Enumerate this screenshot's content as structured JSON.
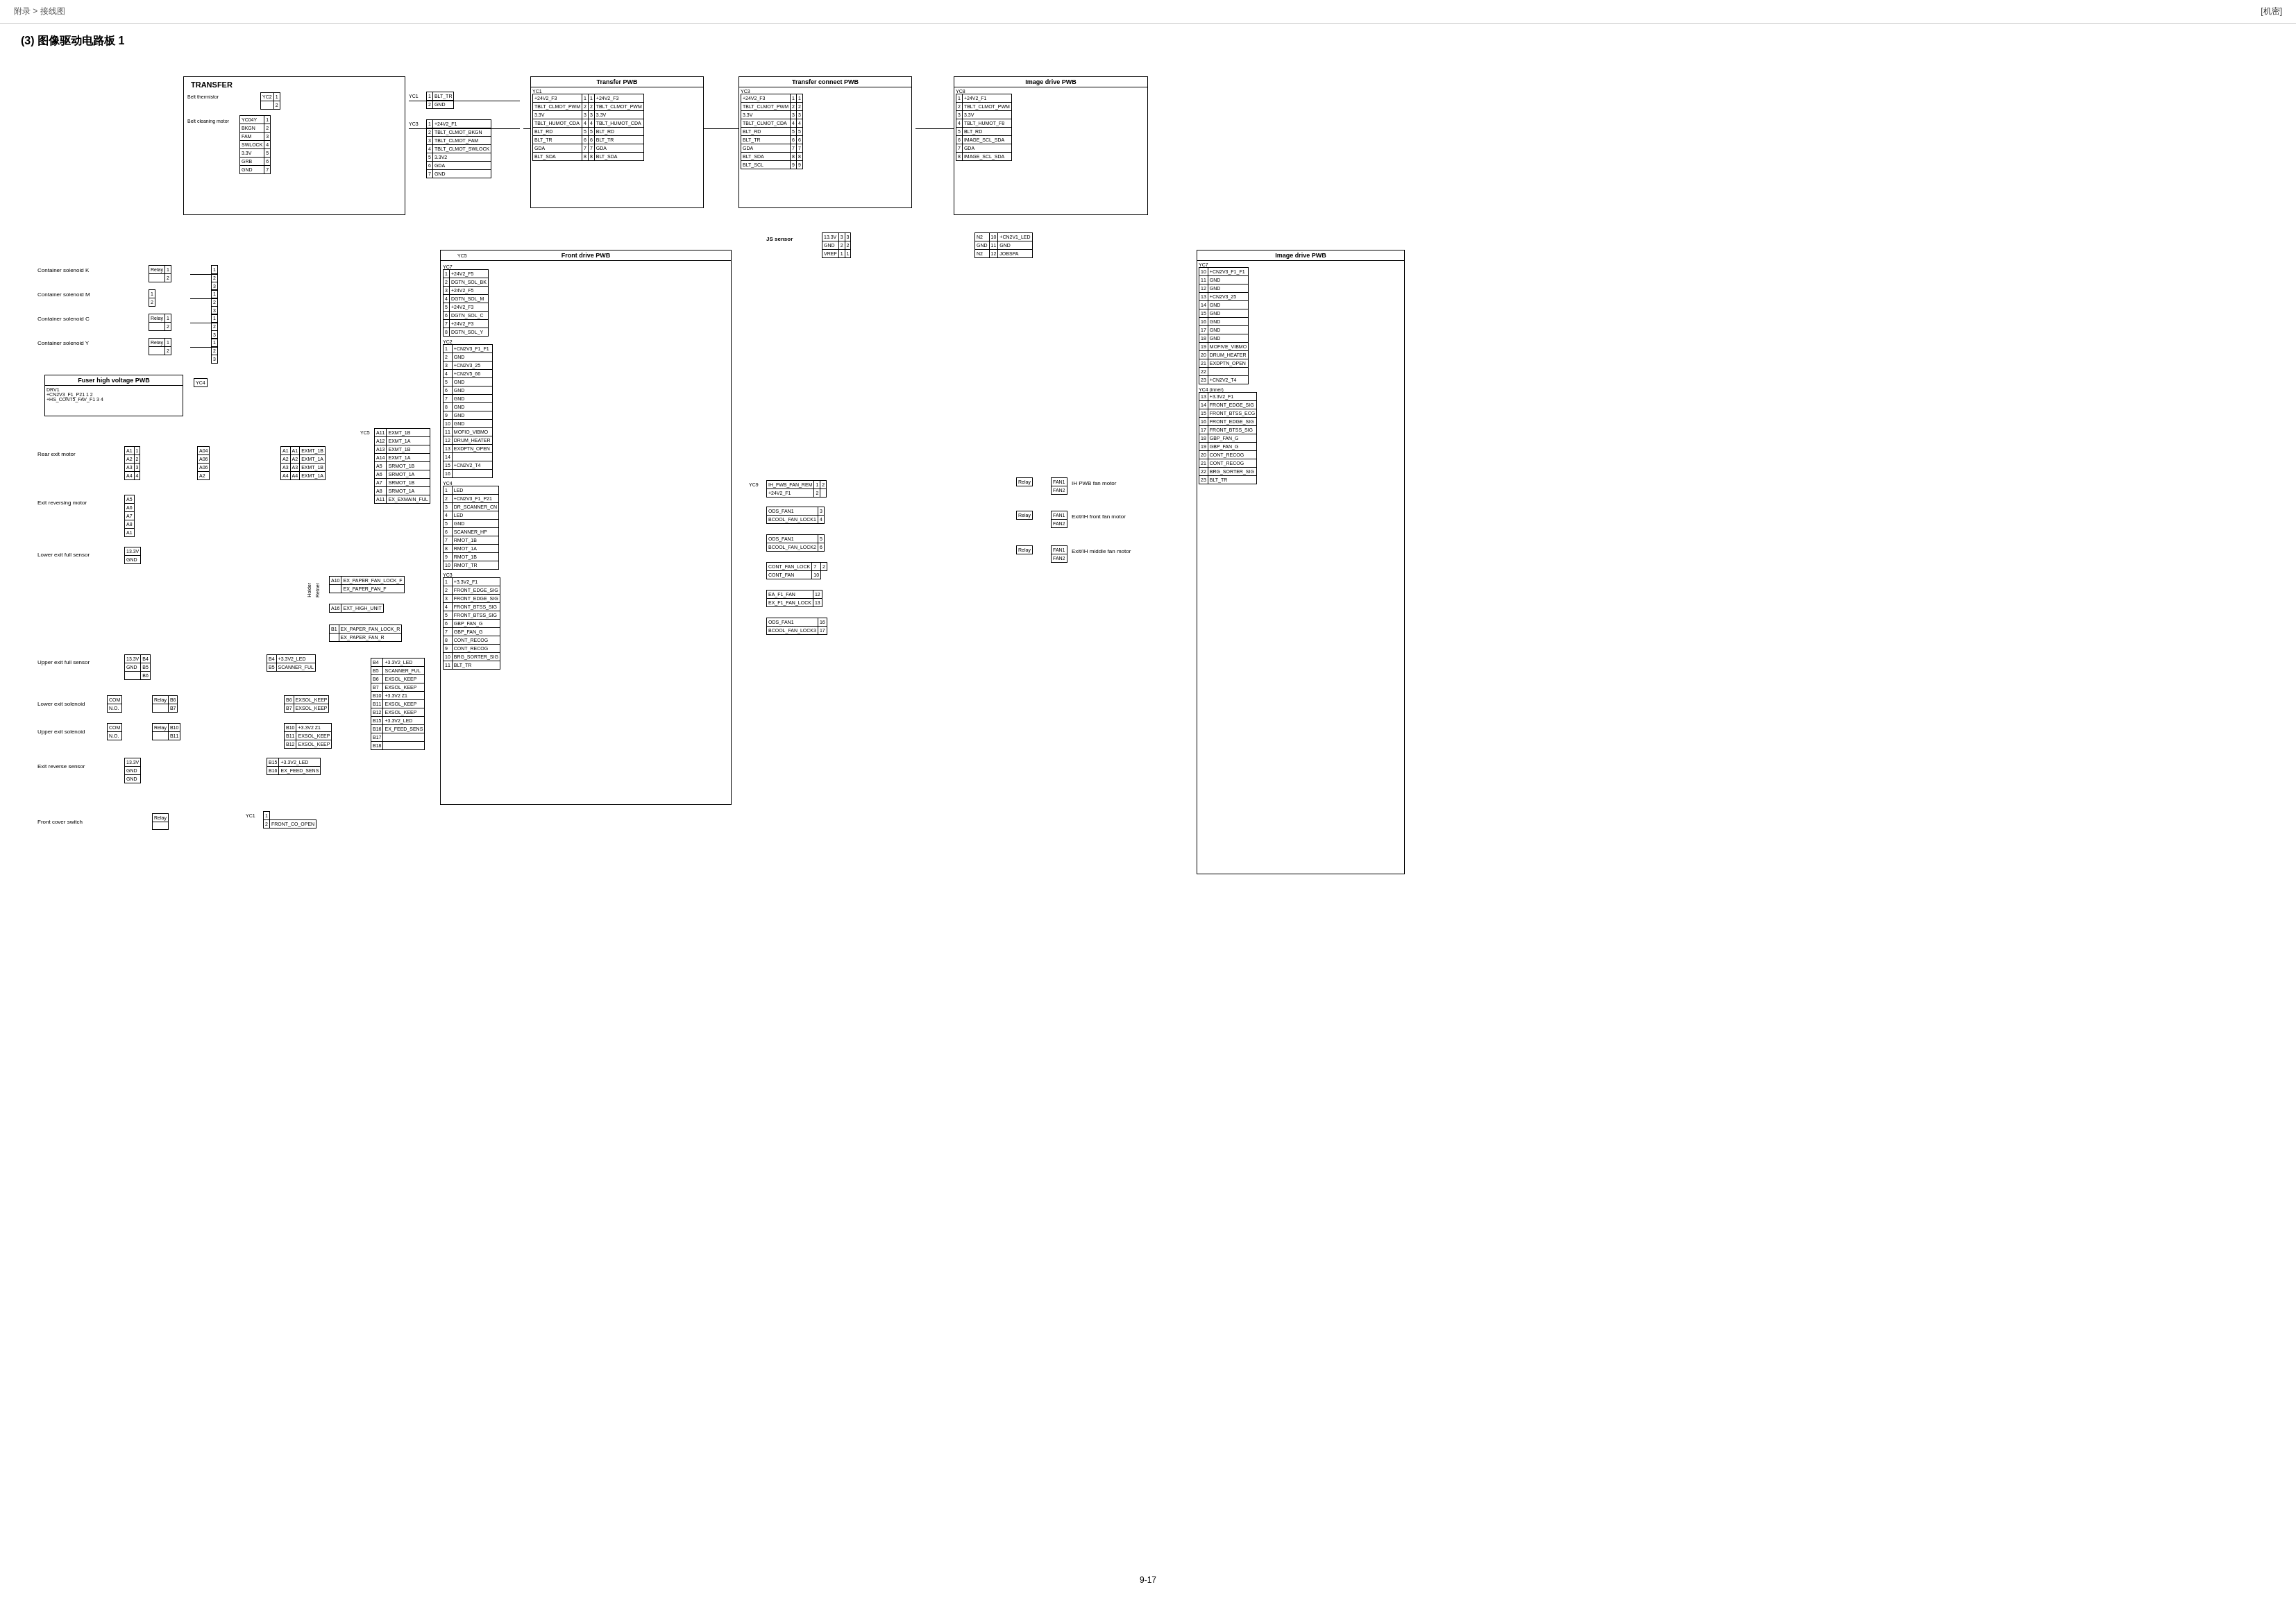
{
  "header": {
    "breadcrumb": "附录 > 接线图",
    "tag": "[机密]"
  },
  "section": {
    "title": "(3) 图像驱动电路板 1"
  },
  "blocks": {
    "transfer_pwb": "Transfer PWB",
    "transfer_connect_pwb": "Transfer connect PWB",
    "image_drive_pwb": "Image drive PWB",
    "front_drive_pwb": "Front drive PWB",
    "js_sensor": "JS sensor",
    "fuser_high_voltage": "Fuser high voltage PWB",
    "transfer_label": "TRANSFER"
  },
  "components": {
    "front_cover_switch": "Front cover switch",
    "belt_thermistor": "Belt thermistor",
    "belt_cleaning_motor": "Belt cleaning motor",
    "container_solenoid_k": "Container solenoid K",
    "container_solenoid_m": "Container solenoid M",
    "container_solenoid_c": "Container solenoid C",
    "container_solenoid_y": "Container solenoid Y",
    "rear_exit_motor": "Rear exit motor",
    "exit_reversing_motor": "Exit reversing motor",
    "lower_exit_full_sensor": "Lower exit full sensor",
    "upper_exit_full_sensor": "Upper exit full sensor",
    "lower_exit_solenoid": "Lower exit solenoid",
    "upper_exit_solenoid": "Upper exit solenoid",
    "exit_reverse_sensor": "Exit reverse sensor",
    "ih_pwb_fan_motor": "IH PWB fan motor",
    "exit_ih_front_fan_motor": "Exit/IH front fan motor",
    "exit_ih_middle_fan_motor": "Exit/IH middle fan motor"
  },
  "page_number": "9-17"
}
